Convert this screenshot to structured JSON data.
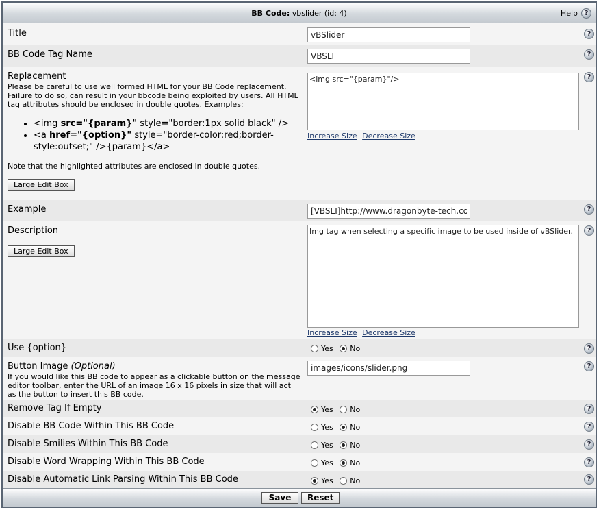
{
  "header": {
    "title_bold": "BB Code:",
    "title_rest": " vbslider (id: 4)",
    "help_label": "Help",
    "help_glyph": "?"
  },
  "fields": {
    "title": {
      "label": "Title",
      "value": "vBSlider"
    },
    "tag_name": {
      "label": "BB Code Tag Name",
      "value": "VBSLI"
    },
    "replacement": {
      "label": "Replacement",
      "desc": "Please be careful to use well formed HTML for your BB Code replacement. Failure to do so, can result in your bbcode being exploited by users. All HTML tag attributes should be enclosed in double quotes. Examples:",
      "example1_a": "<img ",
      "example1_b": "src=\"{param}\"",
      "example1_c": " style=\"border:1px solid black\" />",
      "example2_a": "<a ",
      "example2_b": "href=\"{option}\"",
      "example2_c": " style=\"border-color:red;border-style:outset;\" />{param}</a>",
      "note": "Note that the highlighted attributes are enclosed in double quotes.",
      "large_edit": "Large Edit Box",
      "value": "<img src=\"{param}\"/>",
      "increase": "Increase Size",
      "decrease": "Decrease Size"
    },
    "example": {
      "label": "Example",
      "value": "[VBSLI]http://www.dragonbyte-tech.com"
    },
    "description": {
      "label": "Description",
      "large_edit": "Large Edit Box",
      "value": "Img tag when selecting a specific image to be used inside of vBSlider.",
      "increase": "Increase Size",
      "decrease": "Decrease Size"
    },
    "use_option": {
      "label": "Use {option}",
      "selected": "No"
    },
    "button_image": {
      "label": "Button Image",
      "label_optional": "(Optional)",
      "desc": "If you would like this BB code to appear as a clickable button on the message editor toolbar, enter the URL of an image 16 x 16 pixels in size that will act as the button to insert this BB code.",
      "value": "images/icons/slider.png"
    },
    "remove_tag": {
      "label": "Remove Tag If Empty",
      "selected": "Yes"
    },
    "disable_bbcode": {
      "label": "Disable BB Code Within This BB Code",
      "selected": "No"
    },
    "disable_smilies": {
      "label": "Disable Smilies Within This BB Code",
      "selected": "No"
    },
    "disable_wrap": {
      "label": "Disable Word Wrapping Within This BB Code",
      "selected": "No"
    },
    "disable_links": {
      "label": "Disable Automatic Link Parsing Within This BB Code",
      "selected": "Yes"
    }
  },
  "radio_labels": {
    "yes": "Yes",
    "no": "No"
  },
  "footer": {
    "save": "Save",
    "reset": "Reset"
  }
}
